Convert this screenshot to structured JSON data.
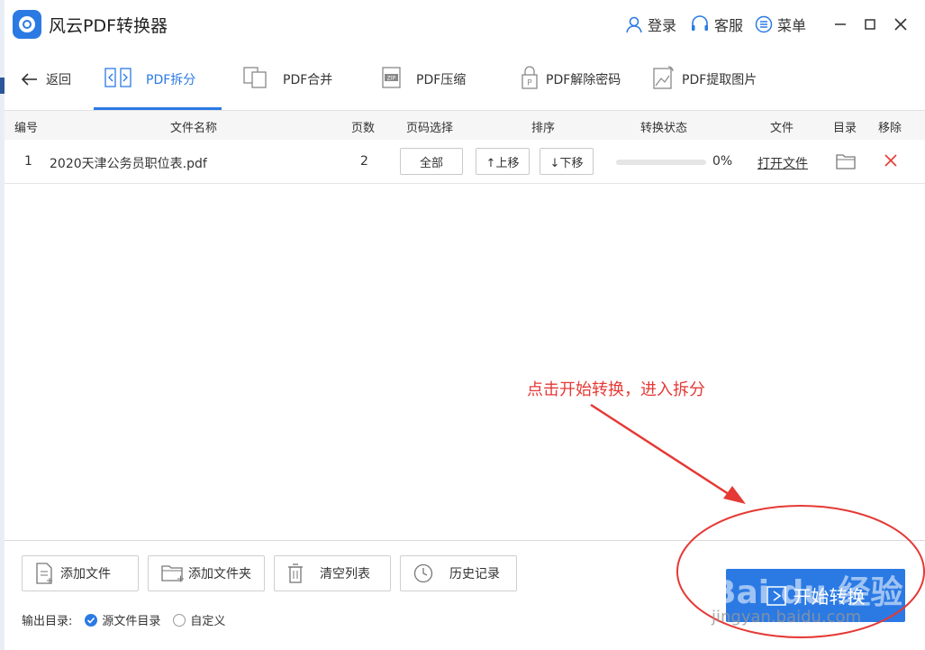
{
  "app": {
    "title": "风云PDF转换器"
  },
  "titlebar": {
    "login": "登录",
    "support": "客服",
    "menu": "菜单"
  },
  "nav": {
    "back": "返回",
    "tabs": [
      {
        "label": "PDF拆分",
        "icon": "split-icon",
        "active": true
      },
      {
        "label": "PDF合并",
        "icon": "merge-icon"
      },
      {
        "label": "PDF压缩",
        "icon": "zip-icon"
      },
      {
        "label": "PDF解除密码",
        "icon": "unlock-icon"
      },
      {
        "label": "PDF提取图片",
        "icon": "image-icon"
      }
    ]
  },
  "table": {
    "headers": {
      "index": "编号",
      "name": "文件名称",
      "pages": "页数",
      "page_select": "页码选择",
      "order": "排序",
      "status": "转换状态",
      "file": "文件",
      "dir": "目录",
      "remove": "移除"
    },
    "rows": [
      {
        "index": "1",
        "name": "2020天津公务员职位表.pdf",
        "pages": "2",
        "page_select": "全部",
        "move_up": "↑上移",
        "move_down": "↓下移",
        "progress_label": "0%",
        "progress": 0,
        "open_file": "打开文件"
      }
    ]
  },
  "annotation": {
    "text": "点击开始转换，进入拆分",
    "color": "#e53935"
  },
  "footer": {
    "add_file": "添加文件",
    "add_folder": "添加文件夹",
    "clear_list": "清空列表",
    "history": "历史记录",
    "output_label": "输出目录:",
    "output_source": "源文件目录",
    "output_custom": "自定义",
    "start": "开始转换"
  },
  "watermark": {
    "brand": "Bai du 经验",
    "url": "jingyan.baidu.com"
  },
  "colors": {
    "accent": "#2b7ae4",
    "annotation": "#e53935"
  }
}
